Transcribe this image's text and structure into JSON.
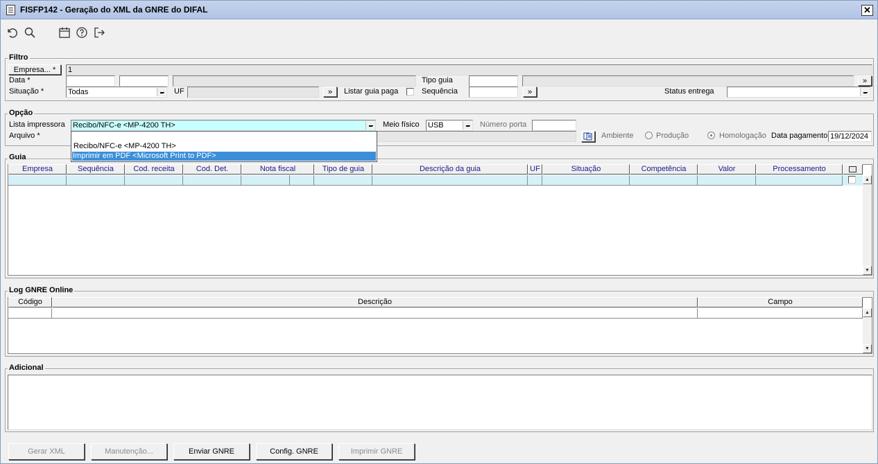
{
  "window": {
    "title": "FISFP142 - Geração do XML da GNRE do DIFAL",
    "close_label": "✕"
  },
  "toolbar": {
    "icons": [
      "undo-icon",
      "search-icon",
      "calendar-icon",
      "help-icon",
      "exit-icon"
    ]
  },
  "filtro": {
    "legend": "Filtro",
    "empresa_button": "Empresa... *",
    "empresa_value": "1",
    "data_label": "Data *",
    "data_from": "",
    "data_to": "",
    "situacao_label": "Situação *",
    "situacao_value": "Todas",
    "uf_label": "UF",
    "uf_value": "",
    "uf_button": "»",
    "listar_label": "Listar guia paga",
    "tipo_guia_label": "Tipo guia",
    "tipo_guia_value": "",
    "tipo_guia_button": "»",
    "sequencia_label": "Sequência",
    "sequencia_value": "",
    "sequencia_button": "»",
    "status_label": "Status entrega",
    "status_value": ""
  },
  "opcao": {
    "legend": "Opção",
    "lista_label": "Lista impressora",
    "lista_value": "Recibo/NFC-e <MP-4200 TH>",
    "lista_options": [
      "Recibo/NFC-e <MP-4200 TH>",
      "Imprimir em PDF <Microsoft Print to PDF>"
    ],
    "arquivo_label": "Arquivo *",
    "arquivo_value": "",
    "meio_label": "Meio físico",
    "meio_value": "USB",
    "porta_label": "Número porta",
    "porta_value": "",
    "ambiente_label": "Ambiente",
    "producao_label": "Produção",
    "homologacao_label": "Homologação",
    "data_pag_label": "Data pagamento",
    "data_pag_value": "19/12/2024"
  },
  "guia": {
    "legend": "Guia",
    "columns": [
      "Empresa",
      "Sequência",
      "Cod. receita",
      "Cod. Det.",
      "Nota fiscal",
      "Tipo de guia",
      "Descrição da guia",
      "UF",
      "Situação",
      "Competência",
      "Valor",
      "Processamento"
    ]
  },
  "log": {
    "legend": "Log GNRE Online",
    "columns": [
      "Código",
      "Descrição",
      "Campo"
    ]
  },
  "adicional": {
    "legend": "Adicional",
    "value": ""
  },
  "buttons": {
    "gerar": "Gerar XML",
    "manutencao": "Manutenção...",
    "enviar": "Enviar GNRE",
    "config": "Config. GNRE",
    "imprimir": "Imprimir GNRE"
  },
  "colors": {
    "title_bg": "#b9c9e8",
    "grid_row": "#d6f0f8",
    "combo_highlight": "#c8ffff",
    "selection": "#3b8fd9"
  }
}
